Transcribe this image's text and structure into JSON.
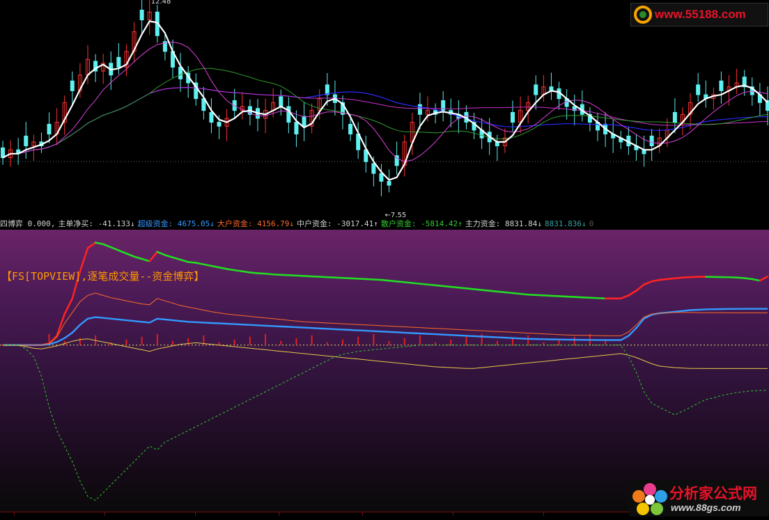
{
  "upper": {
    "high_label": "12.48",
    "low_label": "←7.55"
  },
  "infobar": [
    {
      "text": "四博弈 0.000,",
      "color": "#d0d0d0"
    },
    {
      "text": "主单净买: -41.133↓",
      "color": "#d0d0d0"
    },
    {
      "text": "超级资金: 4675.05↓",
      "color": "#3399ff"
    },
    {
      "text": "大户资金: 4156.79↓",
      "color": "#ff6a2a"
    },
    {
      "text": "中户资金: -3017.41↑",
      "color": "#d0d0d0"
    },
    {
      "text": "散户资金: -5814.42↑",
      "color": "#33cc33"
    },
    {
      "text": "主力资金: 8831.84↓",
      "color": "#d0d0d0"
    },
    {
      "text": "8831.836↓",
      "color": "#3a9fa0"
    },
    {
      "text": "0",
      "color": "#555555"
    }
  ],
  "lower": {
    "indicator_title": "【FS[TOPVIEW],逐笔成交量--资金博弈】"
  },
  "watermarks": {
    "top": "www.55188.com",
    "bottom_title": "分析家公式网",
    "bottom_url": "www.88gs.com"
  },
  "colors": {
    "up_candle": "#ff3333",
    "down_candle": "#5ff0f0",
    "main_force_green": "#22dd22",
    "main_force_red": "#ff2222",
    "super_blue": "#3399ff",
    "big_orange": "#ff6a2a",
    "mid_yellow": "#e6c84a",
    "retail_dashed_green": "#2ecc2e"
  },
  "chart_data": {
    "type": "line",
    "price_close": [
      8.7,
      8.9,
      8.8,
      9.0,
      9.1,
      9.0,
      9.3,
      9.6,
      10.1,
      10.4,
      10.8,
      11.2,
      10.9,
      11.1,
      10.8,
      11.0,
      11.4,
      11.9,
      12.2,
      12.4,
      11.8,
      11.4,
      11.0,
      10.7,
      10.6,
      10.2,
      9.9,
      9.6,
      9.5,
      9.7,
      9.9,
      10.0,
      9.8,
      9.7,
      9.9,
      10.1,
      10.0,
      9.6,
      9.3,
      9.5,
      9.9,
      10.2,
      10.3,
      10.1,
      9.8,
      9.3,
      8.9,
      8.6,
      8.3,
      8.1,
      8.0,
      8.5,
      9.1,
      9.6,
      9.8,
      9.9,
      9.8,
      9.9,
      9.8,
      9.7,
      9.6,
      9.4,
      9.2,
      9.1,
      9.0,
      9.2,
      9.6,
      9.9,
      10.1,
      10.3,
      10.5,
      10.4,
      10.2,
      10.0,
      9.9,
      9.8,
      9.6,
      9.4,
      9.3,
      9.2,
      9.1,
      9.0,
      8.9,
      8.8,
      9.0,
      9.2,
      9.4,
      9.6,
      9.8,
      10.1,
      10.3,
      10.2,
      10.3,
      10.4,
      10.5,
      10.6,
      10.5,
      10.3,
      10.1,
      9.9
    ],
    "price_ylim": [
      7.4,
      12.6
    ],
    "price_markers": {
      "high": 12.48,
      "low": 7.55
    },
    "series": [
      {
        "name": "主力资金",
        "values": [
          0,
          0,
          0,
          0,
          0,
          0,
          200,
          1200,
          4000,
          6000,
          9500,
          12500,
          13200,
          13000,
          12600,
          12200,
          11800,
          11400,
          11100,
          10800,
          12000,
          11600,
          11300,
          11000,
          10700,
          10600,
          10400,
          10200,
          10000,
          9800,
          9650,
          9500,
          9350,
          9250,
          9200,
          9100,
          9050,
          9000,
          8950,
          8900,
          8850,
          8800,
          8750,
          8700,
          8650,
          8600,
          8550,
          8500,
          8450,
          8400,
          8300,
          8200,
          8100,
          8000,
          7900,
          7800,
          7700,
          7600,
          7500,
          7400,
          7300,
          7200,
          7100,
          7000,
          6900,
          6800,
          6700,
          6600,
          6500,
          6450,
          6400,
          6350,
          6300,
          6250,
          6200,
          6150,
          6100,
          6050,
          6000,
          6000,
          6000,
          6400,
          7000,
          7800,
          8200,
          8400,
          8500,
          8600,
          8700,
          8750,
          8800,
          8800,
          8780,
          8760,
          8740,
          8700,
          8620,
          8500,
          8300,
          8831.84
        ]
      },
      {
        "name": "超级资金",
        "values": [
          0,
          0,
          0,
          0,
          0,
          0,
          100,
          400,
          900,
          1600,
          2600,
          3400,
          3600,
          3500,
          3400,
          3300,
          3200,
          3100,
          3000,
          2900,
          3400,
          3300,
          3200,
          3100,
          3000,
          2950,
          2900,
          2850,
          2800,
          2750,
          2700,
          2650,
          2600,
          2550,
          2500,
          2450,
          2400,
          2350,
          2300,
          2250,
          2200,
          2150,
          2100,
          2050,
          2000,
          1950,
          1900,
          1850,
          1800,
          1750,
          1700,
          1650,
          1600,
          1550,
          1500,
          1450,
          1400,
          1350,
          1300,
          1250,
          1200,
          1150,
          1100,
          1050,
          1000,
          950,
          900,
          850,
          800,
          780,
          760,
          740,
          720,
          700,
          690,
          680,
          670,
          660,
          650,
          650,
          650,
          1200,
          2200,
          3400,
          3900,
          4100,
          4200,
          4300,
          4400,
          4500,
          4550,
          4600,
          4620,
          4640,
          4660,
          4670,
          4670,
          4675,
          4675,
          4675.05
        ]
      },
      {
        "name": "大户资金",
        "values": [
          0,
          0,
          0,
          0,
          0,
          0,
          200,
          1000,
          2800,
          4200,
          5600,
          6400,
          6700,
          6400,
          6100,
          5900,
          5700,
          5500,
          5300,
          5200,
          6000,
          5700,
          5400,
          5100,
          4900,
          4700,
          4500,
          4300,
          4150,
          4000,
          3900,
          3800,
          3700,
          3600,
          3500,
          3400,
          3300,
          3200,
          3100,
          3000,
          2950,
          2900,
          2850,
          2800,
          2750,
          2700,
          2650,
          2600,
          2550,
          2500,
          2450,
          2400,
          2350,
          2300,
          2250,
          2200,
          2150,
          2100,
          2050,
          2000,
          1950,
          1900,
          1850,
          1800,
          1750,
          1700,
          1650,
          1600,
          1550,
          1500,
          1450,
          1400,
          1350,
          1300,
          1280,
          1260,
          1240,
          1220,
          1200,
          1200,
          1200,
          1700,
          2600,
          3600,
          4000,
          4100,
          4150,
          4200,
          4200,
          4200,
          4180,
          4170,
          4165,
          4160,
          4158,
          4157,
          4156.9,
          4156.8,
          4156.8,
          4156.79
        ]
      },
      {
        "name": "中户资金",
        "values": [
          0,
          0,
          0,
          -200,
          -400,
          -500,
          -300,
          -100,
          200,
          500,
          700,
          800,
          600,
          400,
          200,
          0,
          -200,
          -400,
          -600,
          -800,
          -500,
          -300,
          -100,
          100,
          200,
          300,
          200,
          100,
          0,
          -100,
          -200,
          -300,
          -400,
          -500,
          -600,
          -700,
          -800,
          -900,
          -1000,
          -1100,
          -1200,
          -1300,
          -1400,
          -1500,
          -1600,
          -1700,
          -1800,
          -1900,
          -2000,
          -2100,
          -2200,
          -2300,
          -2400,
          -2500,
          -2600,
          -2700,
          -2800,
          -2850,
          -2900,
          -2950,
          -3000,
          -3000,
          -2900,
          -2800,
          -2700,
          -2600,
          -2500,
          -2400,
          -2300,
          -2200,
          -2100,
          -2000,
          -1900,
          -1800,
          -1700,
          -1600,
          -1500,
          -1400,
          -1300,
          -1200,
          -1100,
          -1300,
          -1600,
          -2000,
          -2400,
          -2700,
          -2800,
          -2900,
          -2950,
          -3000,
          -3010,
          -3015,
          -3016,
          -3017,
          -3017,
          -3017,
          -3017,
          -3017,
          -3017.3,
          -3017.41
        ]
      },
      {
        "name": "散户资金",
        "values": [
          0,
          0,
          0,
          -500,
          -1500,
          -4000,
          -8000,
          -11000,
          -13000,
          -15000,
          -17500,
          -19500,
          -20000,
          -19000,
          -18000,
          -17000,
          -16000,
          -15000,
          -14000,
          -13000,
          -13500,
          -12500,
          -12000,
          -11500,
          -11000,
          -10500,
          -10000,
          -9500,
          -9000,
          -8500,
          -8000,
          -7500,
          -7000,
          -6500,
          -6000,
          -5500,
          -5000,
          -4500,
          -4000,
          -3500,
          -3000,
          -2500,
          -2000,
          -1500,
          -1200,
          -1000,
          -800,
          -700,
          -600,
          -500,
          -400,
          -300,
          -200,
          -100,
          0,
          0,
          0,
          0,
          0,
          0,
          0,
          0,
          0,
          0,
          0,
          0,
          0,
          0,
          0,
          0,
          0,
          0,
          0,
          0,
          0,
          0,
          0,
          0,
          0,
          0,
          0,
          -1500,
          -3500,
          -6000,
          -7500,
          -8000,
          -8500,
          -9000,
          -8500,
          -8000,
          -7500,
          -7000,
          -6800,
          -6500,
          -6300,
          -6100,
          -6000,
          -5900,
          -5850,
          -5814.42
        ]
      }
    ],
    "ylim": [
      -21000,
      14500
    ]
  }
}
